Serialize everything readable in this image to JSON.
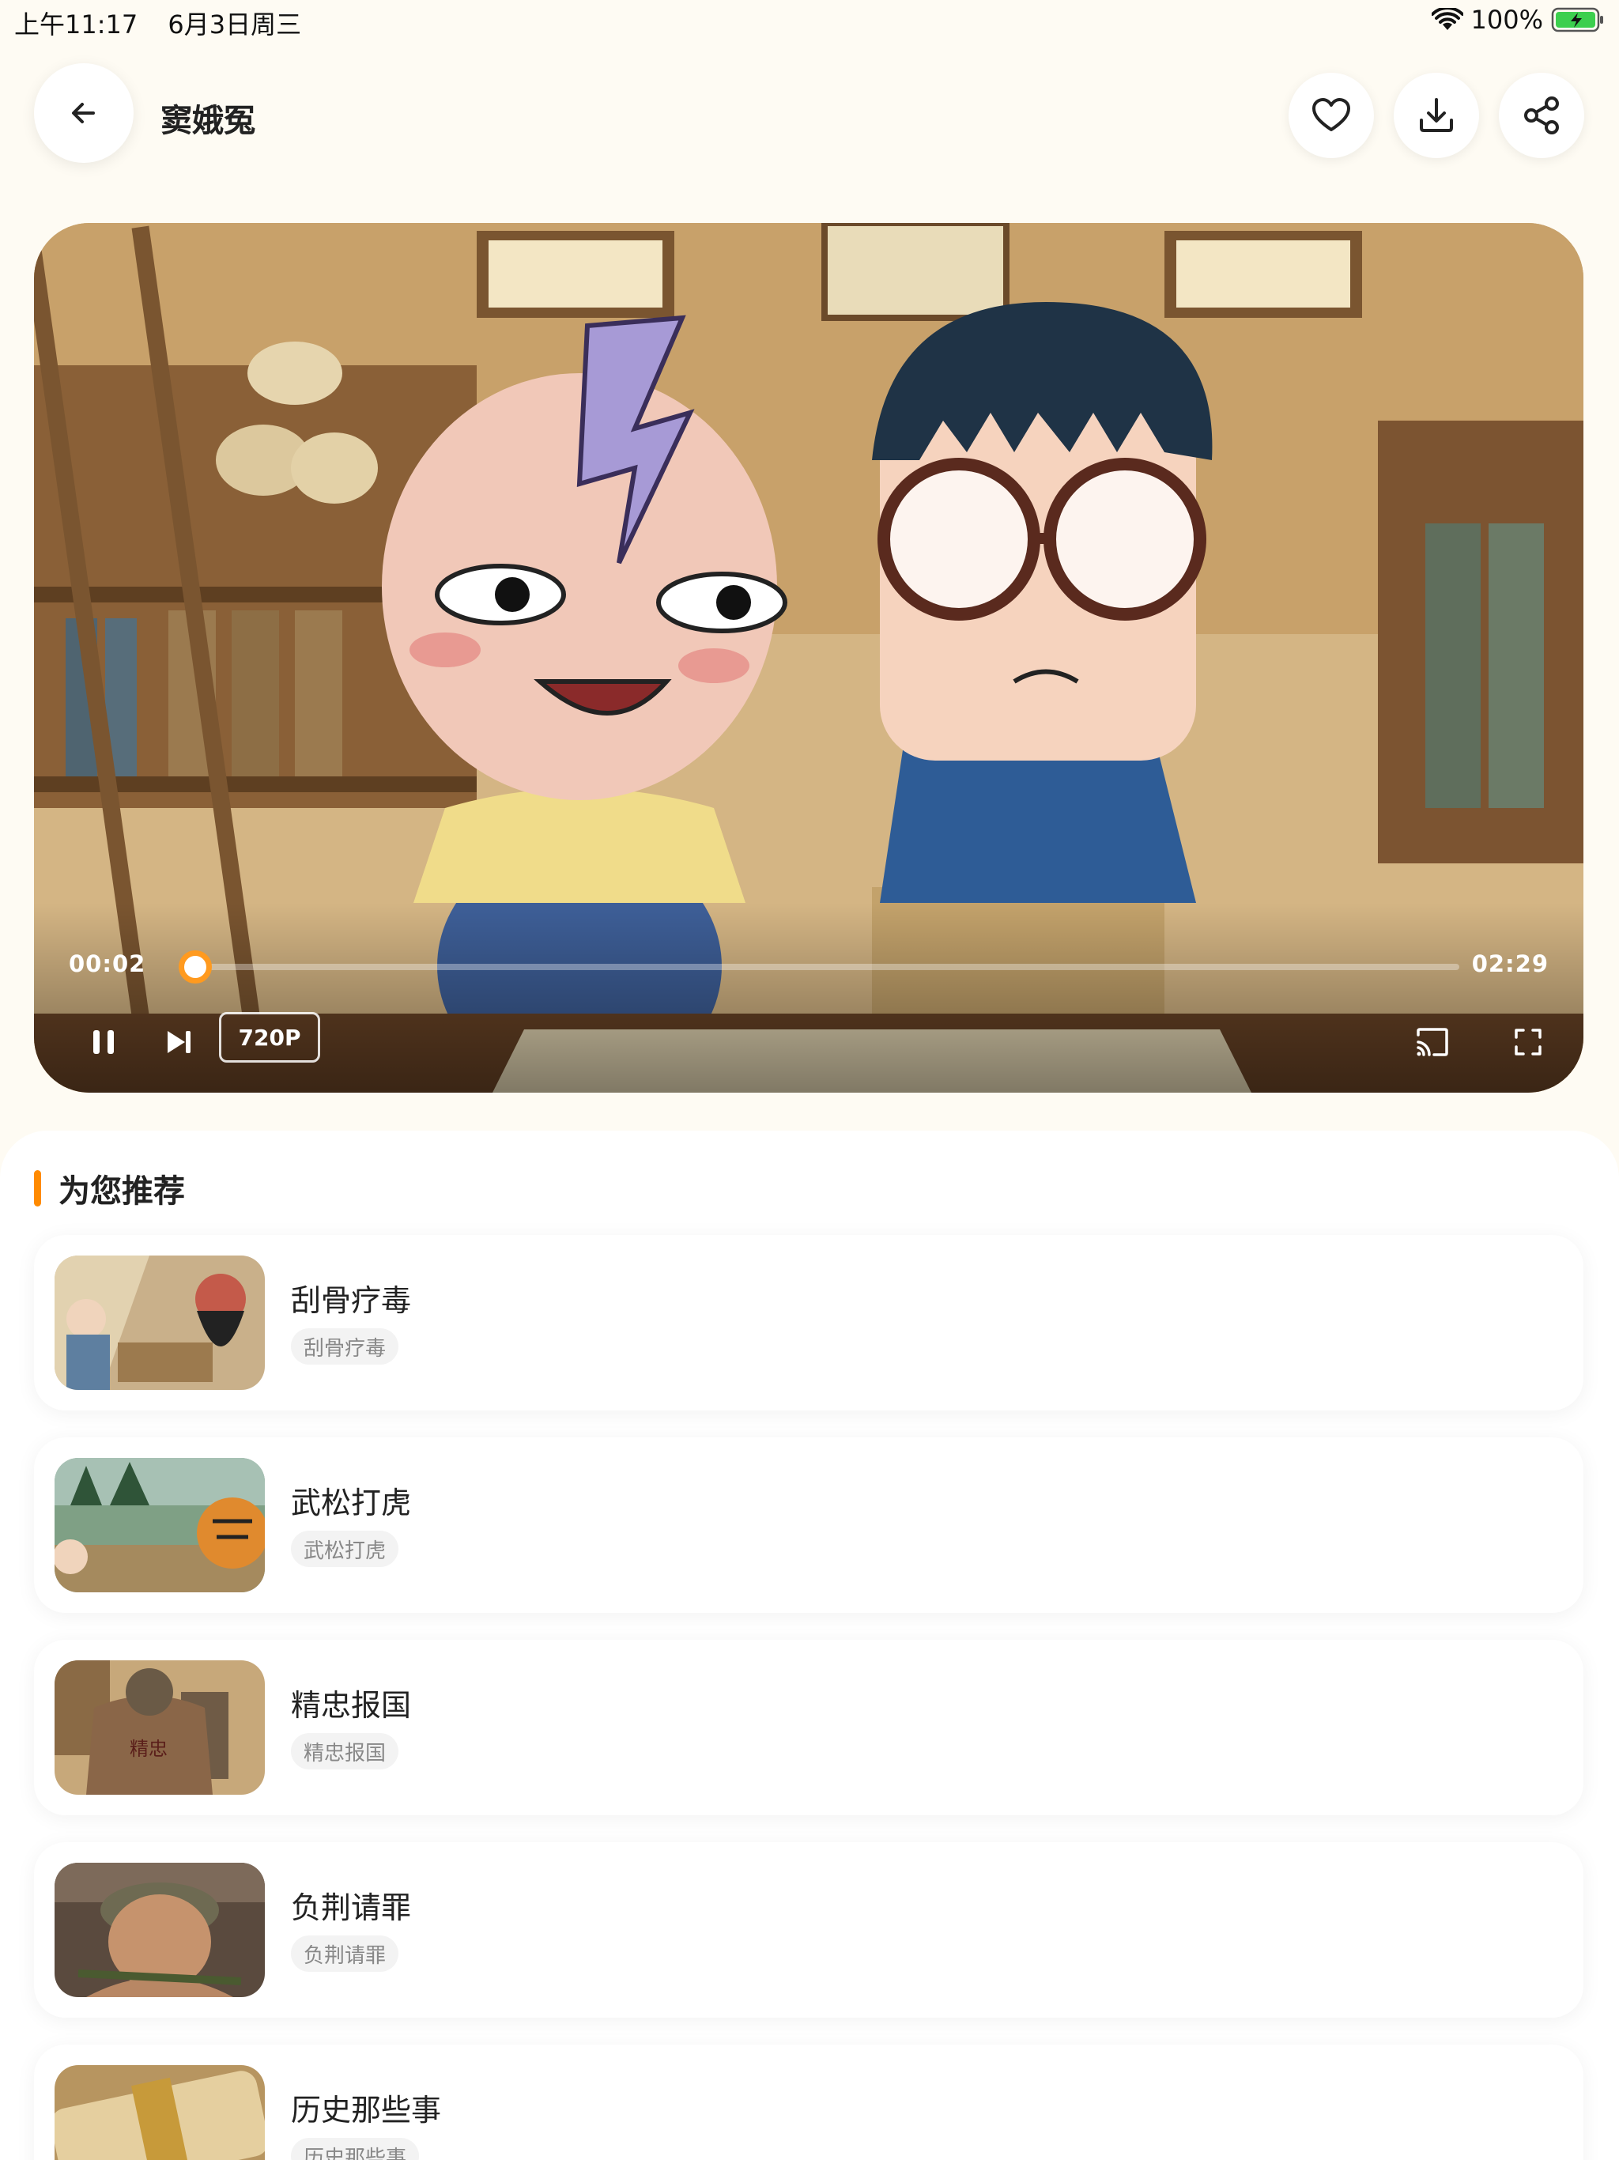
{
  "status_bar": {
    "time": "上午11:17",
    "date": "6月3日周三",
    "battery": "100%"
  },
  "header": {
    "title": "窦娥冤"
  },
  "player": {
    "current_time": "00:02",
    "total_time": "02:29",
    "progress": 0.013,
    "quality": "720P"
  },
  "recommend": {
    "title": "为您推荐",
    "items": [
      {
        "name": "刮骨疗毒",
        "tag": "刮骨疗毒"
      },
      {
        "name": "武松打虎",
        "tag": "武松打虎"
      },
      {
        "name": "精忠报国",
        "tag": "精忠报国"
      },
      {
        "name": "负荆请罪",
        "tag": "负荆请罪"
      },
      {
        "name": "历史那些事",
        "tag": "历史那些事"
      }
    ]
  },
  "colors": {
    "accent": "#ff8a00",
    "background": "#fefbf3"
  }
}
